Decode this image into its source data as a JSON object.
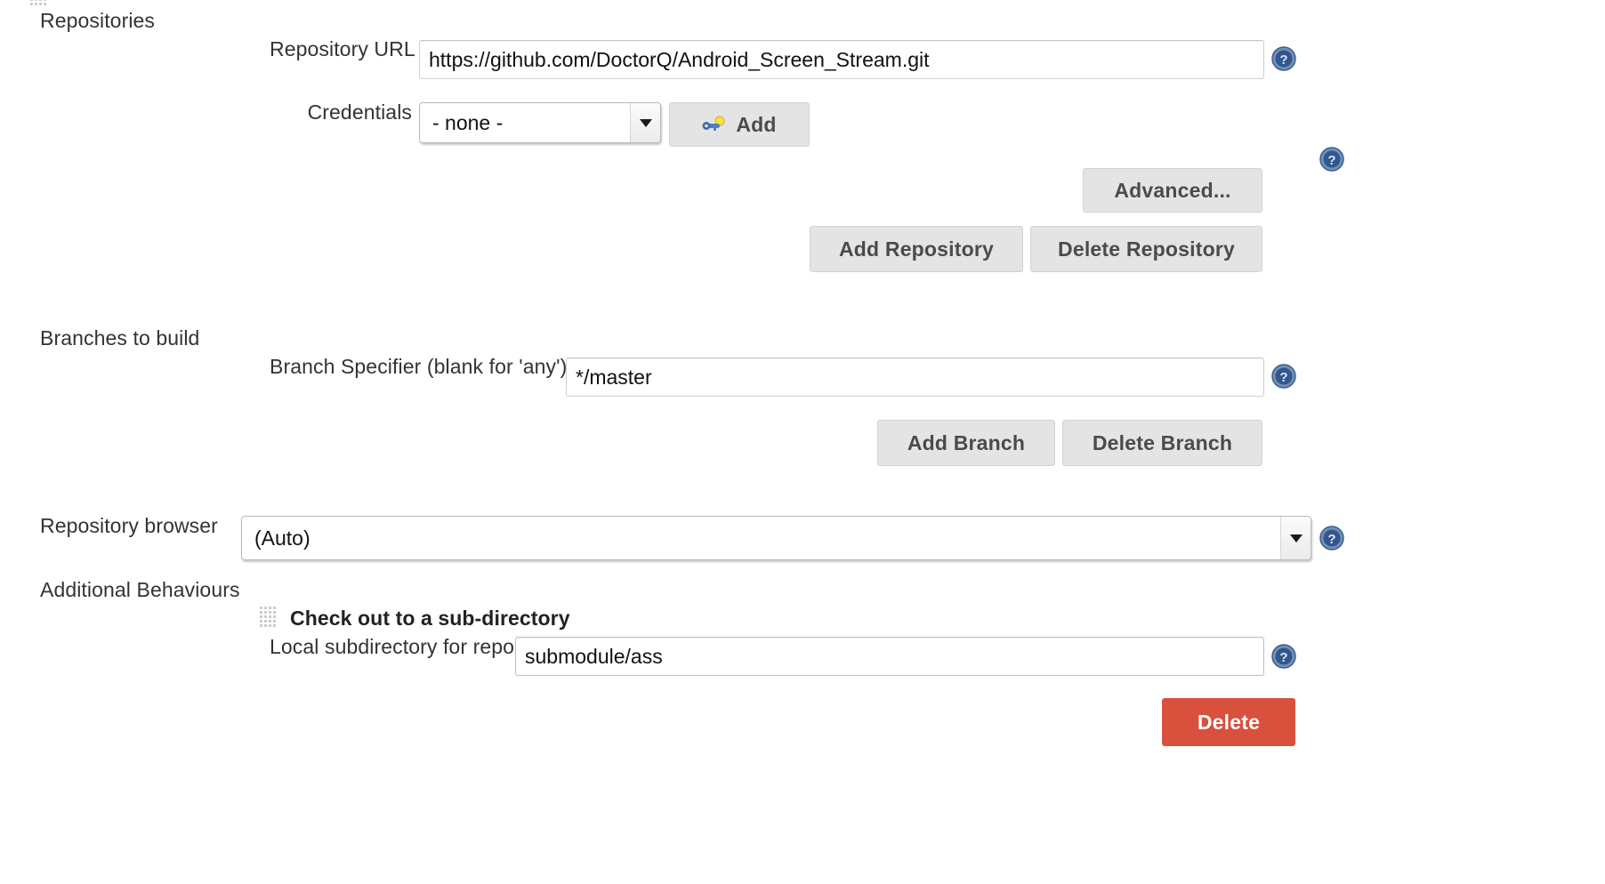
{
  "sections": {
    "repositories": {
      "label": "Repositories"
    },
    "branches": {
      "label": "Branches to build"
    },
    "repository_browser": {
      "label": "Repository browser"
    },
    "additional_behaviours": {
      "label": "Additional Behaviours"
    }
  },
  "repository": {
    "url_label": "Repository URL",
    "url_value": "https://github.com/DoctorQ/Android_Screen_Stream.git",
    "credentials_label": "Credentials",
    "credentials_value": "- none -",
    "credentials_options": [
      "- none -"
    ],
    "add_credentials_label": "Add",
    "add_credentials_icon": "key-icon",
    "advanced_label": "Advanced...",
    "add_repository_label": "Add Repository",
    "delete_repository_label": "Delete Repository"
  },
  "branch": {
    "specifier_label": "Branch Specifier (blank for 'any')",
    "specifier_value": "*/master",
    "add_branch_label": "Add Branch",
    "delete_branch_label": "Delete Branch"
  },
  "browser": {
    "value": "(Auto)",
    "options": [
      "(Auto)"
    ]
  },
  "behaviour": {
    "title": "Check out to a sub-directory",
    "subdirectory_label": "Local subdirectory for repo",
    "subdirectory_value": "submodule/ass",
    "delete_label": "Delete"
  },
  "icons": {
    "help": "help-icon",
    "drag_handle": "drag-handle-icon",
    "dropdown": "chevron-down-icon"
  },
  "colors": {
    "danger": "#d9503c",
    "button_face": "#e4e4e4",
    "text": "#333333",
    "help_blue": "#4a6e9e"
  }
}
